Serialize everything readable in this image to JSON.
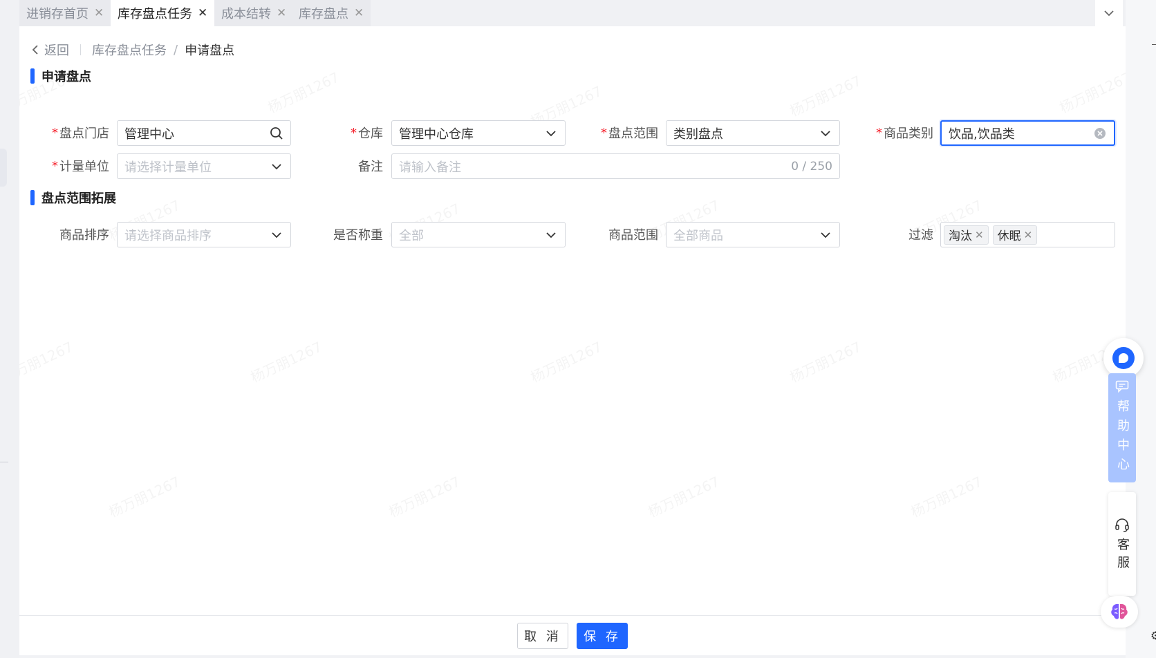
{
  "tabs": [
    {
      "label": "进销存首页",
      "active": false
    },
    {
      "label": "库存盘点任务",
      "active": true
    },
    {
      "label": "成本结转",
      "active": false
    },
    {
      "label": "库存盘点",
      "active": false
    }
  ],
  "breadcrumb": {
    "back": "返回",
    "parent": "库存盘点任务",
    "separator": "/",
    "current": "申请盘点"
  },
  "section1": {
    "title": "申请盘点",
    "store": {
      "label": "盘点门店",
      "value": "管理中心"
    },
    "warehouse": {
      "label": "仓库",
      "value": "管理中心仓库"
    },
    "scope": {
      "label": "盘点范围",
      "value": "类别盘点"
    },
    "category": {
      "label": "商品类别",
      "value": "饮品,饮品类"
    },
    "unit": {
      "label": "计量单位",
      "placeholder": "请选择计量单位"
    },
    "remark": {
      "label": "备注",
      "placeholder": "请输入备注",
      "counter": "0 / 250"
    }
  },
  "section2": {
    "title": "盘点范围拓展",
    "sort": {
      "label": "商品排序",
      "placeholder": "请选择商品排序"
    },
    "weighing": {
      "label": "是否称重",
      "placeholder": "全部"
    },
    "goods_scope": {
      "label": "商品范围",
      "placeholder": "全部商品"
    },
    "filter": {
      "label": "过滤",
      "tags": [
        "淘汰",
        "休眠"
      ]
    }
  },
  "footer": {
    "cancel": "取 消",
    "save": "保 存"
  },
  "floating": {
    "help": {
      "title": "帮助中心"
    },
    "service": {
      "title": "客服"
    }
  },
  "watermark_text": "杨万朋1267",
  "colors": {
    "primary": "#1f66ff",
    "required": "#f5222d",
    "help_panel": "#a9c4ff"
  }
}
